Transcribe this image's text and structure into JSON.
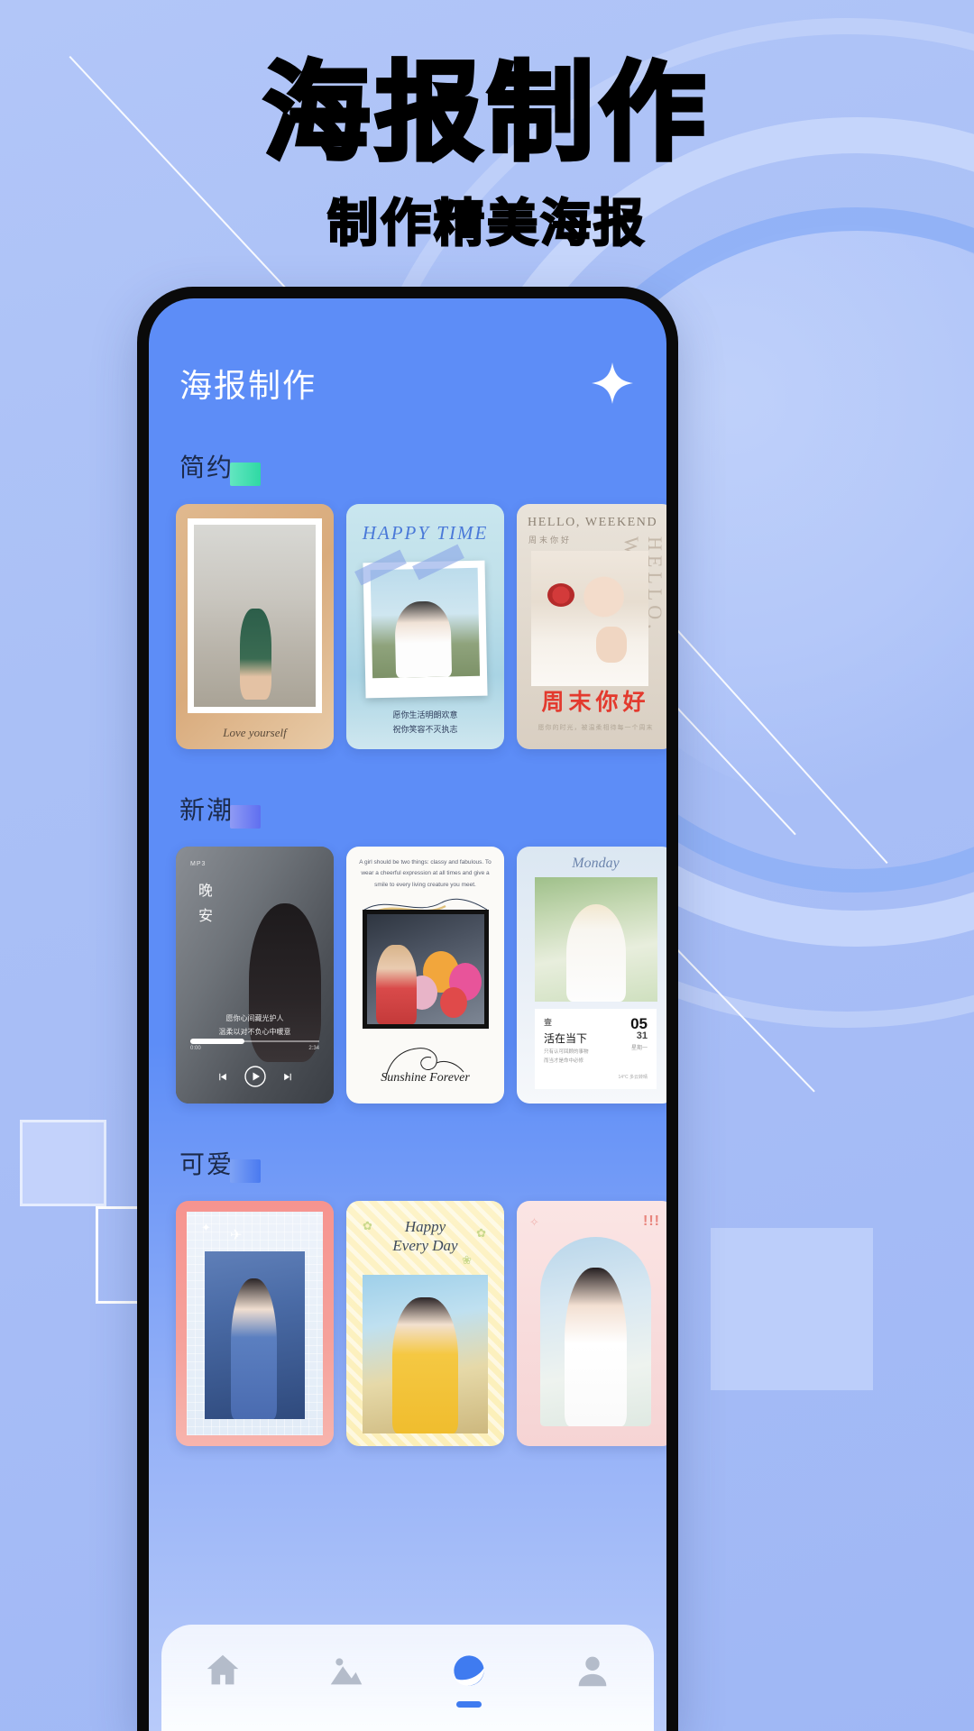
{
  "promo": {
    "title": "海报制作",
    "subtitle": "制作精美海报",
    "bg_color": "#aec4f7",
    "accent_color": "#5d8df7"
  },
  "app": {
    "header_title": "海报制作",
    "sparkle_icon": "sparkle-icon",
    "screen_bg": "#5d8df7"
  },
  "sections": [
    {
      "label": "简约",
      "accent": "#3fe0b0",
      "cards": [
        {
          "name": "love-yourself",
          "caption": "Love yourself"
        },
        {
          "name": "happy-time",
          "title": "HAPPY TIME",
          "caption_line1": "愿你生活明朗欢意",
          "caption_line2": "祝你笑容不灭执志"
        },
        {
          "name": "hello-weekend",
          "title_en": "HELLO, WEEKEND",
          "title_cn": "周末你好",
          "vertical": "HELLO, WEEKEND",
          "headline": "周末你好",
          "footer_line1": "愿你的时光，被温柔相待每一个周末",
          "footer_line2": ""
        }
      ]
    },
    {
      "label": "新潮",
      "accent": "#6f7df0",
      "cards": [
        {
          "name": "good-night-music",
          "badge": "MP3",
          "vertical": "晚安",
          "lyric_line1": "愿你心间藏光护人",
          "lyric_line2": "温柔以对不负心中暖意",
          "time_start": "0:00",
          "time_end": "2:34"
        },
        {
          "name": "sunshine-forever",
          "intro": "A girl should be two things: classy and fabulous. To wear a cheerful expression at all times and give a smile to every living creature you meet.",
          "caption": "Sunshine Forever"
        },
        {
          "name": "monday-calendar",
          "week": "Monday",
          "label_cn": "壹",
          "title_cn": "活在当下",
          "desc_line1": "只有认可回顾的事物",
          "desc_line2": "而当才是命中必修",
          "day": "05",
          "month": "31",
          "day_sub": "星期一",
          "extra": "14°C 多云转晴"
        }
      ]
    },
    {
      "label": "可爱",
      "accent": "#5a86f0",
      "cards": [
        {
          "name": "cute-pink-grid"
        },
        {
          "name": "happy-every-day",
          "title_line1": "Happy",
          "title_line2": "Every Day"
        },
        {
          "name": "cute-girl-pink",
          "mark": "!!!"
        }
      ]
    }
  ],
  "bottom_nav": {
    "items": [
      {
        "name": "nav-home",
        "icon": "home-icon",
        "active": false
      },
      {
        "name": "nav-gallery",
        "icon": "image-icon",
        "active": false
      },
      {
        "name": "nav-discover",
        "icon": "planet-icon",
        "active": true
      },
      {
        "name": "nav-profile",
        "icon": "person-icon",
        "active": false
      }
    ],
    "active_color": "#3f7bf0",
    "inactive_color": "#b4bcca"
  }
}
